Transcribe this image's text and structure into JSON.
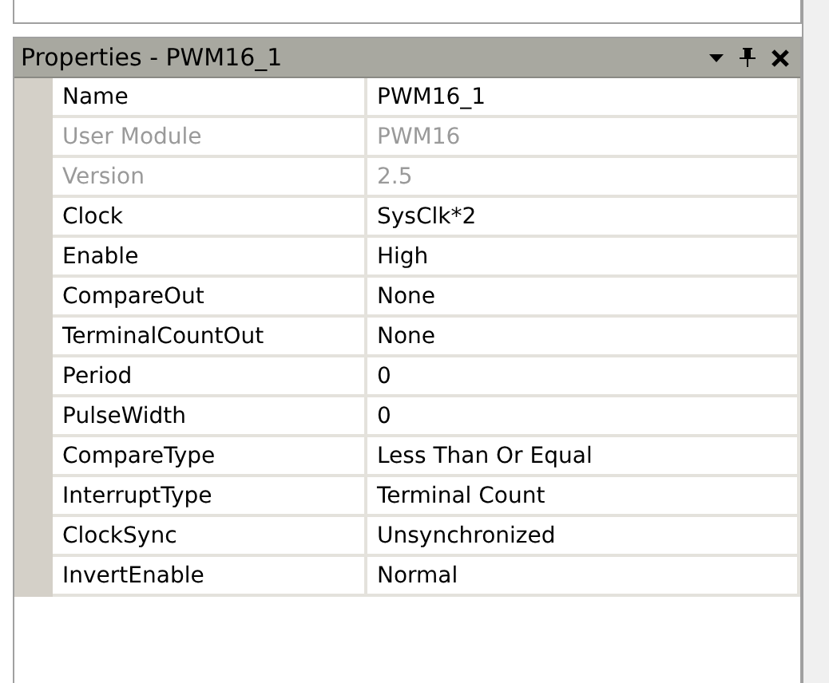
{
  "panel": {
    "title": "Properties - PWM16_1"
  },
  "properties": [
    {
      "name": "Name",
      "value": "PWM16_1",
      "disabled": false
    },
    {
      "name": "User Module",
      "value": "PWM16",
      "disabled": true
    },
    {
      "name": "Version",
      "value": "2.5",
      "disabled": true
    },
    {
      "name": "Clock",
      "value": "SysClk*2",
      "disabled": false
    },
    {
      "name": "Enable",
      "value": "High",
      "disabled": false
    },
    {
      "name": "CompareOut",
      "value": "None",
      "disabled": false
    },
    {
      "name": "TerminalCountOut",
      "value": "None",
      "disabled": false
    },
    {
      "name": "Period",
      "value": "0",
      "disabled": false
    },
    {
      "name": "PulseWidth",
      "value": "0",
      "disabled": false
    },
    {
      "name": "CompareType",
      "value": "Less Than Or Equal",
      "disabled": false
    },
    {
      "name": "InterruptType",
      "value": "Terminal Count",
      "disabled": false
    },
    {
      "name": "ClockSync",
      "value": "Unsynchronized",
      "disabled": false
    },
    {
      "name": "InvertEnable",
      "value": "Normal",
      "disabled": false
    }
  ]
}
